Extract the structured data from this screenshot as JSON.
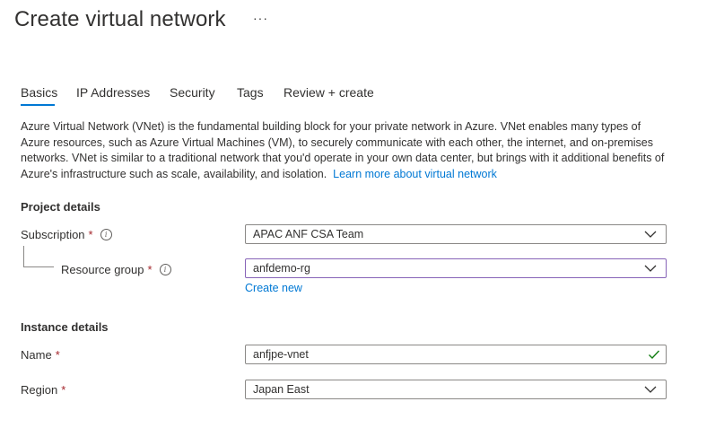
{
  "header": {
    "title": "Create virtual network",
    "more_label": "···"
  },
  "tabs": [
    {
      "label": "Basics",
      "active": true
    },
    {
      "label": "IP Addresses"
    },
    {
      "label": "Security"
    },
    {
      "label": "Tags"
    },
    {
      "label": "Review + create"
    }
  ],
  "description": {
    "text": "Azure Virtual Network (VNet) is the fundamental building block for your private network in Azure. VNet enables many types of Azure resources, such as Azure Virtual Machines (VM), to securely communicate with each other, the internet, and on-premises networks. VNet is similar to a traditional network that you'd operate in your own data center, but brings with it additional benefits of Azure's infrastructure such as scale, availability, and isolation.",
    "link": "Learn more about virtual network"
  },
  "project": {
    "heading": "Project details",
    "subscription": {
      "label": "Subscription",
      "required": "*",
      "value": "APAC ANF CSA Team"
    },
    "resource_group": {
      "label": "Resource group",
      "required": "*",
      "value": "anfdemo-rg",
      "create_new": "Create new"
    }
  },
  "instance": {
    "heading": "Instance details",
    "name": {
      "label": "Name",
      "required": "*",
      "value": "anfjpe-vnet"
    },
    "region": {
      "label": "Region",
      "required": "*",
      "value": "Japan East"
    }
  },
  "colors": {
    "accent": "#0078d4",
    "required": "#a4262c",
    "valid": "#107c10",
    "focus_border": "#8764b8"
  },
  "icons": {
    "info": "info-icon",
    "dropdown": "chevron-down-icon",
    "valid": "checkmark-icon"
  }
}
